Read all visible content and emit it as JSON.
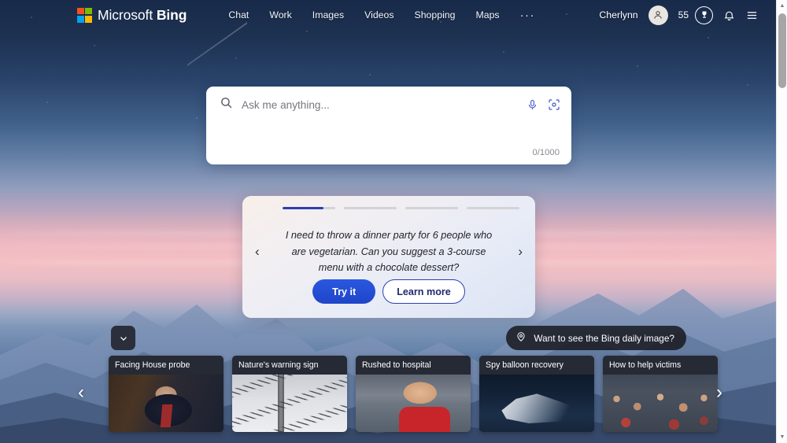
{
  "header": {
    "brand": {
      "prefix": "Microsoft",
      "suffix": "Bing",
      "logo_icon": "microsoft-logo-icon"
    },
    "nav": [
      {
        "label": "Chat"
      },
      {
        "label": "Work"
      },
      {
        "label": "Images"
      },
      {
        "label": "Videos"
      },
      {
        "label": "Shopping"
      },
      {
        "label": "Maps"
      }
    ],
    "more_label": "···",
    "user_name": "Cherlynn",
    "avatar_icon": "person-avatar-icon",
    "points": "55",
    "rewards_icon": "rewards-trophy-icon",
    "notifications_icon": "bell-icon",
    "menu_icon": "hamburger-menu-icon"
  },
  "search": {
    "placeholder": "Ask me anything...",
    "value": "",
    "counter": "0/1000",
    "search_icon": "search-icon",
    "mic_icon": "microphone-icon",
    "visual_icon": "visual-search-icon"
  },
  "suggestion": {
    "progress": {
      "segments": 4,
      "active_index": 0,
      "active_fill_percent": 78
    },
    "prompt": "I need to throw a dinner party for 6 people who are vegetarian. Can you suggest a 3-course menu with a chocolate dessert?",
    "try_label": "Try it",
    "learn_label": "Learn more",
    "prev_icon": "chevron-left-icon",
    "next_icon": "chevron-right-icon"
  },
  "daily_image_pill": {
    "label": "Want to see the Bing daily image?",
    "icon": "location-pin-icon"
  },
  "expand_button": {
    "icon": "chevron-down-icon"
  },
  "news": {
    "prev_icon": "chevron-left-icon",
    "next_icon": "chevron-right-icon",
    "cards": [
      {
        "title": "Facing House probe",
        "image": "img-hearing"
      },
      {
        "title": "Nature's warning sign",
        "image": "img-birds"
      },
      {
        "title": "Rushed to hospital",
        "image": "img-stadium"
      },
      {
        "title": "Spy balloon recovery",
        "image": "img-balloon"
      },
      {
        "title": "How to help victims",
        "image": "img-crowd"
      }
    ]
  },
  "scrollbar": {
    "up_icon": "scroll-up-arrow-icon",
    "down_icon": "scroll-down-arrow-icon"
  },
  "colors": {
    "accent_blue": "#2b3fb5",
    "try_button": "#2548d4",
    "pill_dark": "#181a20",
    "card_header": "#252a35"
  }
}
